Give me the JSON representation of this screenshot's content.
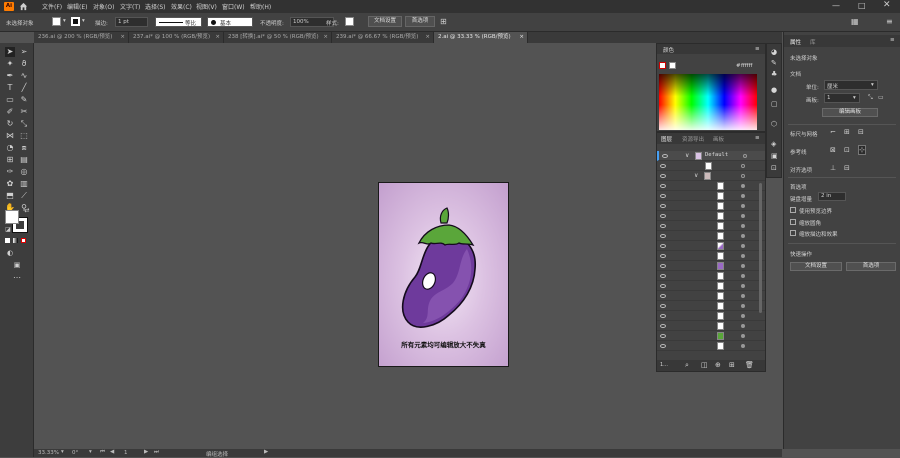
{
  "menubar": {
    "app_logo": "Ai",
    "items": [
      "文件(F)",
      "编辑(E)",
      "对象(O)",
      "文字(T)",
      "选择(S)",
      "效果(C)",
      "视图(V)",
      "窗口(W)",
      "帮助(H)"
    ]
  },
  "control_bar": {
    "selection_label": "未选择对象",
    "stroke_label": "描边:",
    "stroke_value": "1 pt",
    "line_style": "等比",
    "brush_label": "基本",
    "opacity_label": "不透明度:",
    "opacity_value": "100%",
    "style_label": "样式:",
    "doc_setup_button": "文档设置",
    "preferences_button": "首选项"
  },
  "tabs": [
    {
      "label": "236.ai @ 200 % (RGB/预览)",
      "active": false
    },
    {
      "label": "237.ai* @ 100 % (RGB/预览)",
      "active": false
    },
    {
      "label": "238 [转换].ai* @ 50 % (RGB/预览)",
      "active": false
    },
    {
      "label": "239.ai* @ 66.67 % (RGB/预览)",
      "active": false
    },
    {
      "label": "2.ai @ 33.33 % (RGB/预览)",
      "active": true
    }
  ],
  "canvas": {
    "caption": "所有元素均可编辑放大不失真"
  },
  "color_panel": {
    "title": "颜色",
    "hex_value": "ffffff"
  },
  "layers_panel": {
    "tabs": [
      "图层",
      "资源导出",
      "画板"
    ],
    "layer_name": "Default",
    "footer_count": "1..."
  },
  "properties_panel": {
    "tabs": [
      "属性",
      "库"
    ],
    "no_selection": "未选择对象",
    "document_section": "文档",
    "unit_label": "单位:",
    "unit_value": "厘米",
    "artboard_label": "画板:",
    "artboard_value": "1",
    "edit_artboards_button": "编辑画板",
    "rulers_grid_label": "标尺与网格",
    "guides_label": "参考线",
    "align_label": "对齐选项",
    "preferences_section": "首选项",
    "keyboard_increment_label": "键盘增量",
    "keyboard_increment_value": "2 in",
    "checkbox_preview_bounds": "使用预览边界",
    "checkbox_scale_corners": "缩放圆角",
    "checkbox_scale_strokes": "缩放描边和效果",
    "quick_actions_label": "快速操作",
    "quick_doc_setup": "文档设置",
    "quick_preferences": "首选项"
  },
  "status_bar": {
    "zoom": "33.33%",
    "rotation": "0°",
    "artboard": "1",
    "mode": "编组选择"
  },
  "colors": {
    "ui_dark": "#323232",
    "ui_panel": "#424242",
    "canvas_bg": "#535353",
    "accent_blue": "#46a0f5",
    "eggplant": "#6e3a9c",
    "leaf_green": "#5aa63a"
  }
}
